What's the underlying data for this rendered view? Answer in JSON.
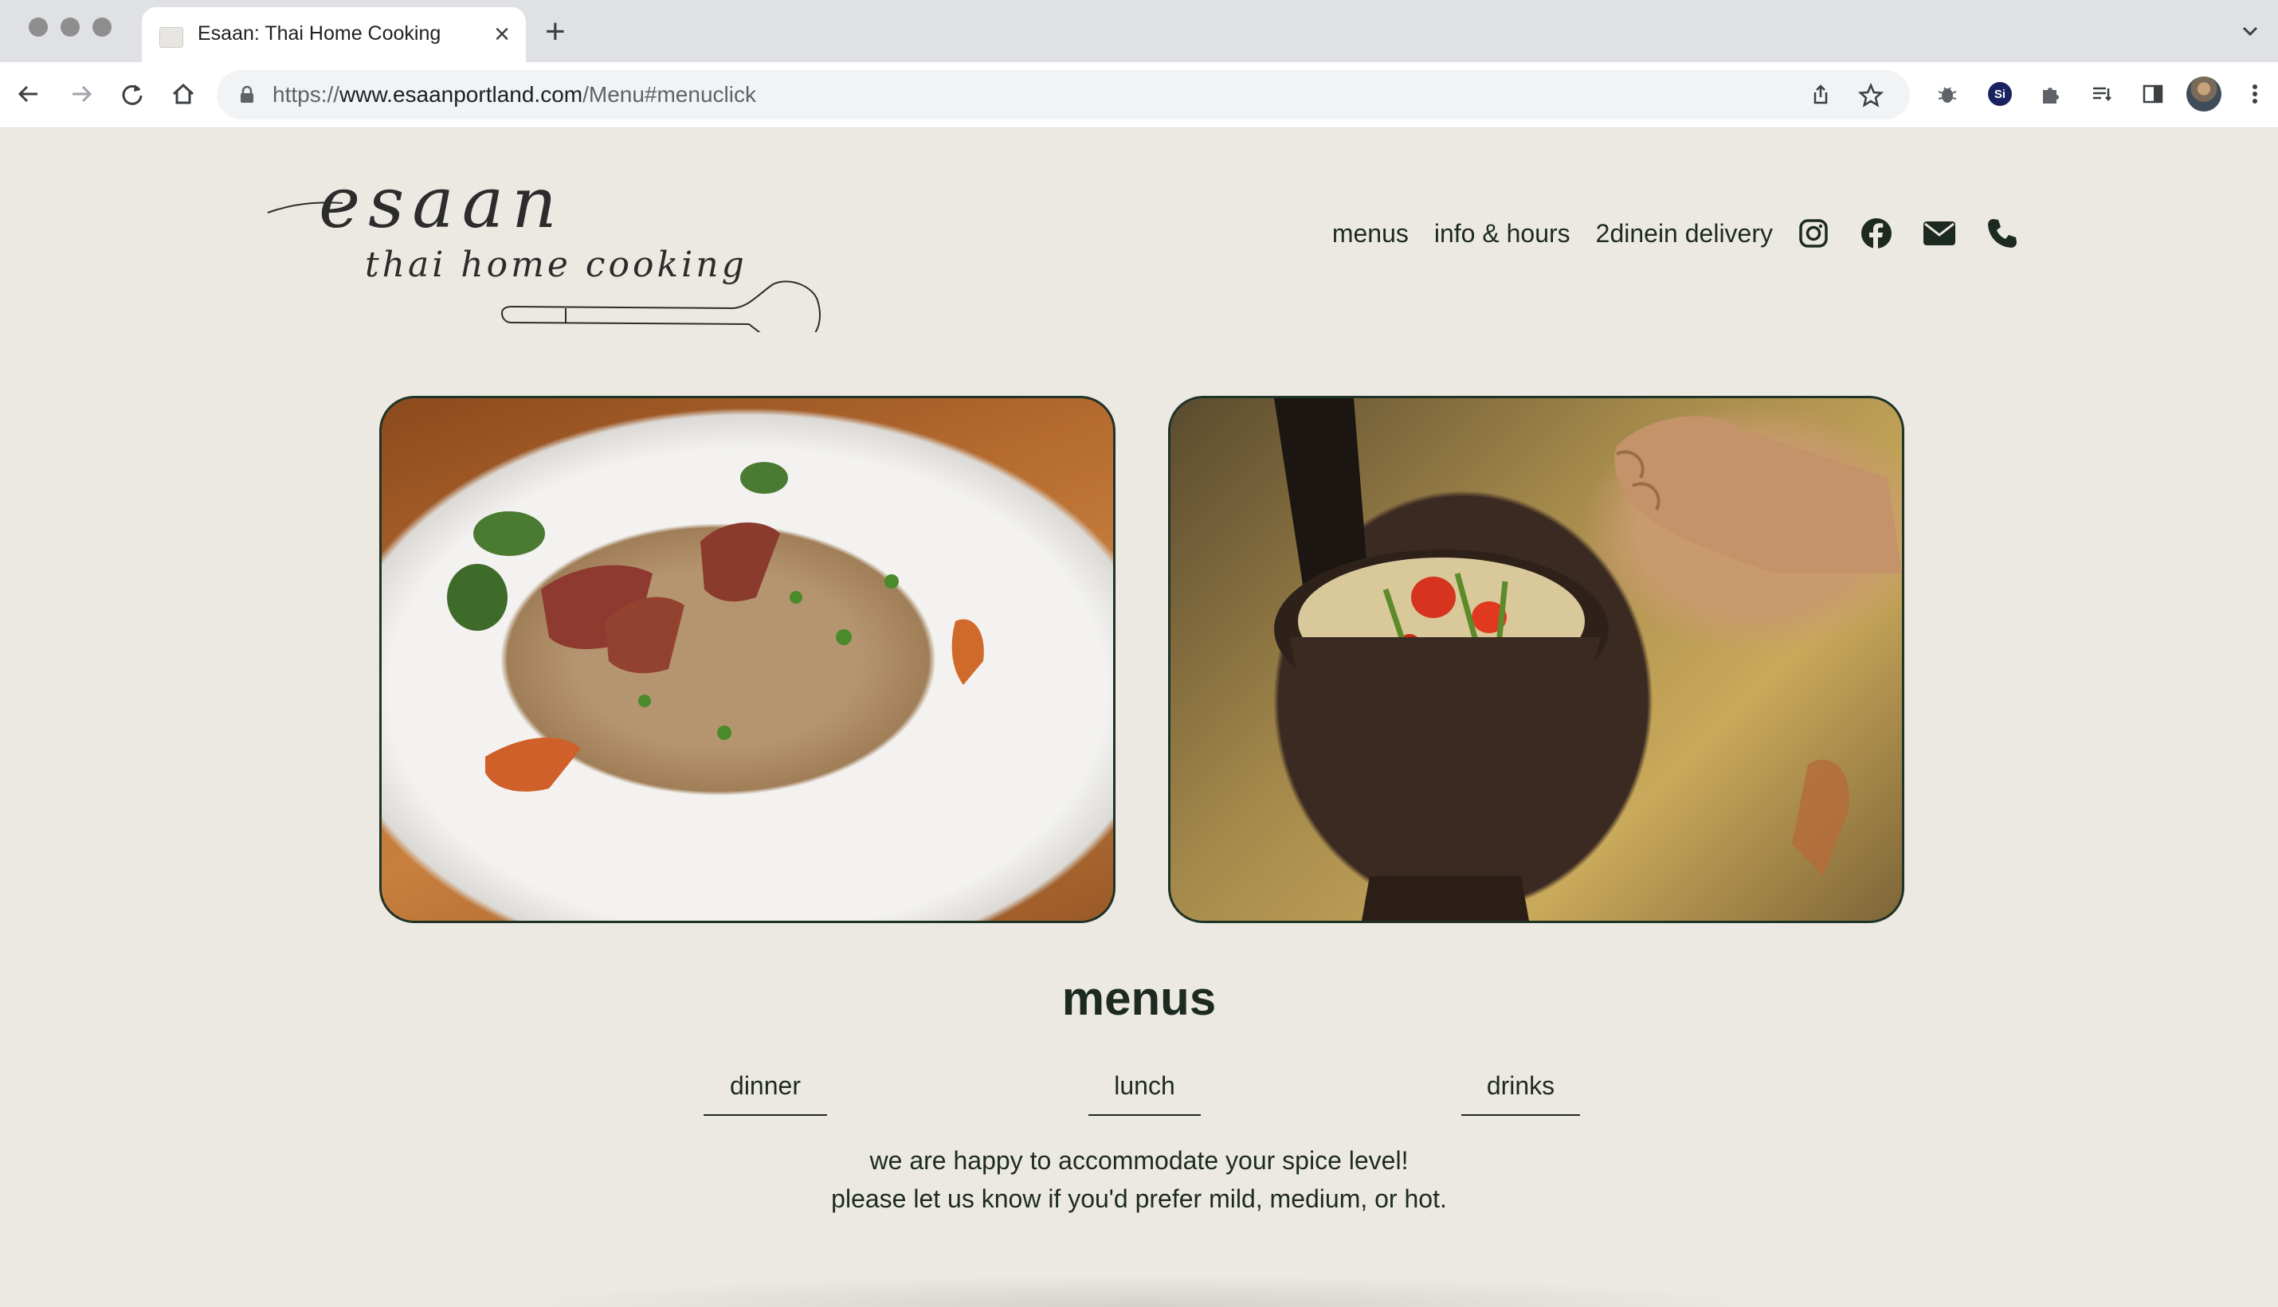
{
  "browser": {
    "tab_title": "Esaan: Thai Home Cooking",
    "url_scheme": "https://",
    "url_host": "www.esaanportland.com",
    "url_path": "/Menu#menuclick",
    "si_badge": "Si"
  },
  "site": {
    "logo": {
      "line1": "esaan",
      "line2": "thai home cooking"
    },
    "nav": {
      "items": [
        "menus",
        "info & hours",
        "2dinein delivery"
      ],
      "social_icons": [
        "instagram-icon",
        "facebook-icon",
        "email-icon",
        "phone-icon"
      ]
    },
    "photos": [
      "fried rice with roast pork",
      "papaya salad in mortar"
    ],
    "menus": {
      "title": "menus",
      "tabs": [
        "dinner",
        "lunch",
        "drinks"
      ],
      "note_line1": "we are happy to accommodate your spice level!",
      "note_line2": "please let us know if you'd prefer mild, medium, or hot."
    },
    "colors": {
      "background": "#ece9e2",
      "text": "#1d2a21"
    }
  }
}
